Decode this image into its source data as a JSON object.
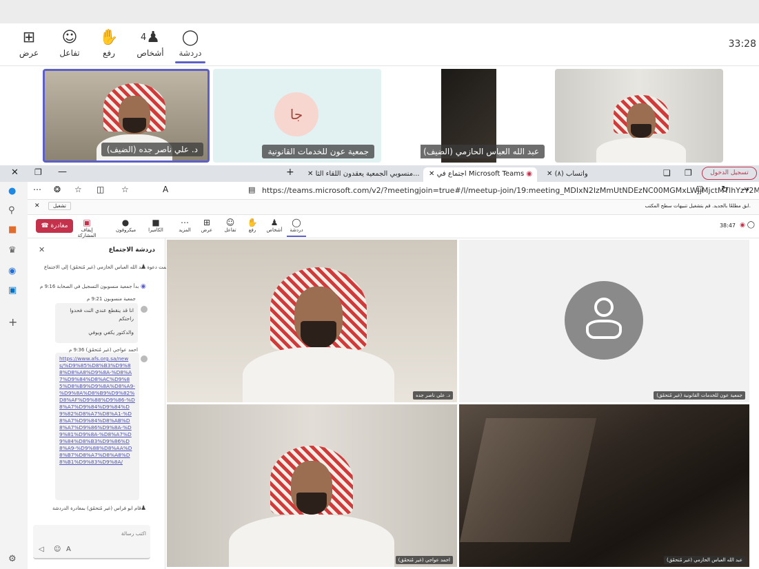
{
  "toolbar": {
    "items": [
      {
        "label": "دردشة",
        "icon": "chat-icon"
      },
      {
        "label": "أشخاص",
        "icon": "people-icon",
        "count": "4"
      },
      {
        "label": "رفع",
        "icon": "raise-hand-icon"
      },
      {
        "label": "تفاعل",
        "icon": "react-icon"
      },
      {
        "label": "عرض",
        "icon": "view-icon"
      }
    ],
    "timer": "33:28"
  },
  "strip": {
    "tiles": [
      {
        "name": "د. علي ناصر جده (الضيف)"
      },
      {
        "name": "جمعية عون للخدمات القانونية",
        "initials": "جا"
      },
      {
        "name": "عبد الله العباس الحازمي (الضيف)"
      },
      {
        "name": ""
      }
    ]
  },
  "browser": {
    "tabs": [
      {
        "title": "تسجيل الدخول"
      },
      {
        "title": "(٨) واتساب"
      },
      {
        "title": "اجتماع في Microsoft Teams"
      },
      {
        "title": "منسوبي الجمعية يعقدون اللقاء الثا..."
      }
    ],
    "url": "https://teams.microsoft.com/v2/?meetingjoin=true#/l/meetup-join/19:meeting_MDIxN2IzMmUtNDEzNC00MGMxLWJjMjctMTlhYzY2MD...",
    "infobar": "ابق مطلعًا بالجديد. قم بتشغيل تنبيهات سطح المكتب.",
    "infobar_btn": "تشغيل"
  },
  "teams": {
    "timer": "38:47",
    "leave_label": "مغادرة",
    "buttons": [
      "دردشة",
      "أشخاص",
      "رفع",
      "تفاعل",
      "عرض",
      "المزيد",
      "الكاميرا",
      "ميكروفون",
      "إيقاف المشاركة"
    ]
  },
  "chat": {
    "title": "دردشة الاجتماع",
    "invite_msg": "تمت دعوة عبد الله العباس الحازمي (غير مُتحقَق) إلى الاجتماع.",
    "recording_time": "9:16 م",
    "recording_msg": "بدأ جمعية منسوبون التسجيل في الصحابة",
    "sender1": "جمعية منسوبون 9:21 م",
    "msg1_line1": "انا قد ينقطع عندي النت فحدوا",
    "msg1_line2": "راحتكم",
    "msg1_line3": "والدكتور يكفي ويوفي",
    "sender2": "احمد عواجي (غير مُتحقَق) 9:36 م",
    "link": "https://www.afs.org.sa/news/%D9%85%D8%B3%D9%88%D8%A8%D9%8A-%D8%A7%D9%84%D8%AC%D9%85%D8%B9%D9%8A%D8%A9-%D9%8A%D8%B9%D9%82%D8%AF%D9%88%D9%86-%D8%A7%D9%84%D9%84%D9%82%D8%A7%D8%A1-%D8%A7%D9%84%D8%AB%D8%A7%D9%86%D9%8A-%D9%81%D9%8A-%D8%A7%D9%84%D8%B3%D9%86%D8%A9-%D9%88%D8%AA%D8%B7%D8%A7%D8%A8%D8%B1%D9%83%D9%8A/",
    "left_msg": "قام ابو فراس (غير مُتحقَق) بمغادرة الدردشة.",
    "compose_placeholder": "اكتب رسالة"
  },
  "grid": {
    "tiles": [
      {
        "name": "د. علي ناصر جده"
      },
      {
        "name": "جمعية عون للخدمات القانونية (غير مُتحقَق)"
      },
      {
        "name": "احمد عواجي (غير مُتحقَق)"
      },
      {
        "name": "عبد الله العباس الحازمي (غير مُتحقَق)"
      }
    ]
  }
}
